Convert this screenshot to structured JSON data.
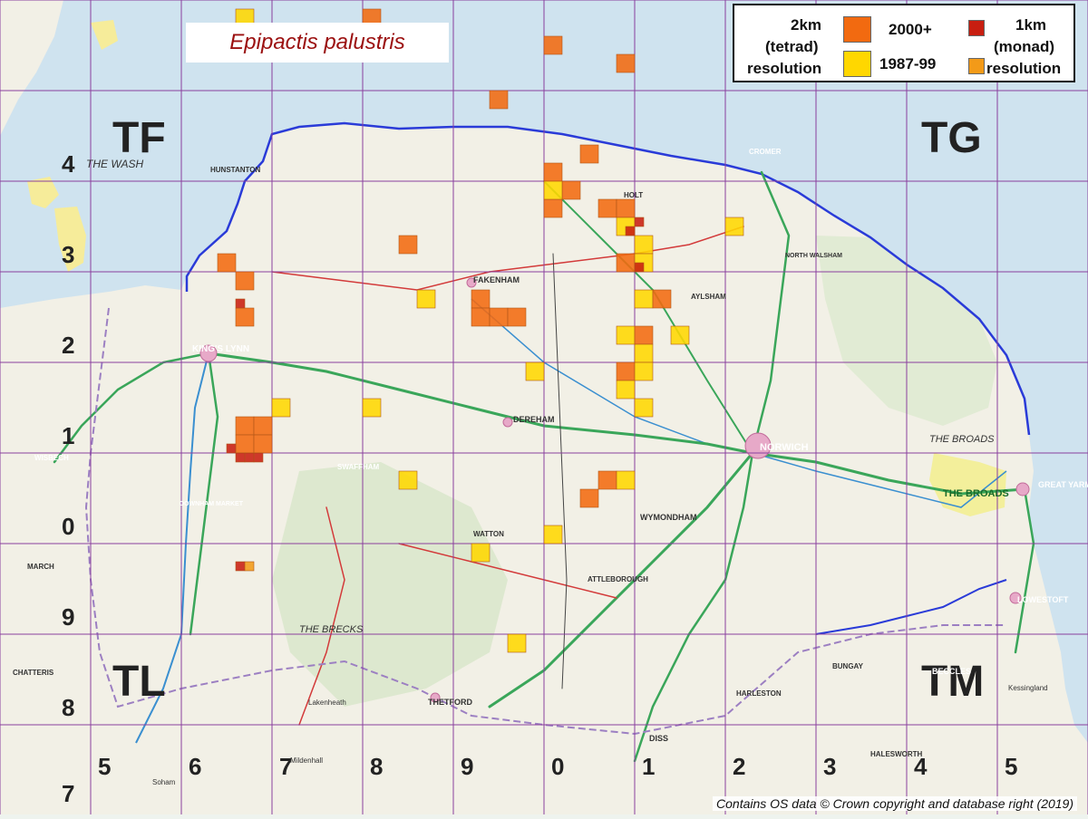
{
  "title": "Epipactis palustris",
  "legend": {
    "tetrad_label_1": "2km",
    "tetrad_label_2": "(tetrad)",
    "tetrad_label_3": "resolution",
    "period_recent": "2000+",
    "period_old": "1987-99",
    "monad_label_1": "1km",
    "monad_label_2": "(monad)",
    "monad_label_3": "resolution"
  },
  "colors": {
    "tetrad_recent": "#f26a10",
    "tetrad_old": "#ffd700",
    "monad_recent": "#c81e10",
    "monad_old": "#f39a18",
    "grid": "#8a3f9e",
    "coast": "#2a3bd8"
  },
  "squares": {
    "tl": "TL",
    "tf": "TF",
    "tg": "TG",
    "tm": "TM"
  },
  "grid_numbers": {
    "left": [
      "4",
      "3",
      "2",
      "1",
      "0",
      "9",
      "8",
      "7"
    ],
    "bottom": [
      "5",
      "6",
      "7",
      "8",
      "9",
      "0",
      "1",
      "2",
      "3",
      "4",
      "5"
    ]
  },
  "copyright": "Contains OS data © Crown copyright and database right (2019)",
  "map_labels": {
    "the_wash": "THE WASH",
    "the_broads_1": "THE BROADS",
    "the_broads_2": "THE BROADS",
    "the_brecks": "THE BRECKS",
    "kings_lynn": "KING'S LYNN",
    "norwich": "NORWICH",
    "great_yarmouth": "GREAT YARMOUTH",
    "lowestoft": "LOWESTOFT",
    "cromer": "CROMER",
    "fakenham": "FAKENHAM",
    "thetford": "THETFORD",
    "beccles": "BECCLES",
    "diss": "DISS",
    "swaffham": "SWAFFHAM",
    "downham_market": "DOWNHAM MARKET",
    "wisbech": "WISBECH",
    "hunstanton": "HUNSTANTON",
    "dereham": "DEREHAM",
    "wymondham": "WYMONDHAM",
    "attleborough": "ATTLEBOROUGH",
    "aylsham": "AYLSHAM",
    "north_walsham": "NORTH WALSHAM",
    "holt": "HOLT",
    "harleston": "HARLESTON",
    "bungay": "BUNGAY",
    "watton": "WATTON",
    "march": "MARCH",
    "chatteris": "CHATTERIS",
    "lakenheath": "Lakenheath",
    "halesworth": "HALESWORTH",
    "soham": "Soham",
    "mildenhall": "Mildenhall",
    "kessingland": "Kessingland"
  },
  "records": [
    {
      "period": "old",
      "res": "tetrad",
      "easting": 572,
      "northing": 345
    },
    {
      "period": "recent",
      "res": "tetrad",
      "easting": 586,
      "northing": 345
    },
    {
      "period": "recent",
      "res": "monad",
      "easting": 585,
      "northing": 344
    },
    {
      "period": "recent",
      "res": "monad",
      "easting": 586,
      "northing": 344
    },
    {
      "period": "recent",
      "res": "monad",
      "easting": 587,
      "northing": 344
    },
    {
      "period": "old",
      "res": "monad",
      "easting": 590,
      "northing": 344
    },
    {
      "period": "recent",
      "res": "monad",
      "easting": 591,
      "northing": 344
    },
    {
      "period": "recent",
      "res": "tetrad",
      "easting": 592,
      "northing": 342
    },
    {
      "period": "recent",
      "res": "tetrad",
      "easting": 606,
      "northing": 342
    },
    {
      "period": "recent",
      "res": "tetrad",
      "easting": 614,
      "northing": 340
    },
    {
      "period": "recent",
      "res": "tetrad",
      "easting": 600,
      "northing": 336
    },
    {
      "period": "recent",
      "res": "tetrad",
      "easting": 610,
      "northing": 330
    },
    {
      "period": "recent",
      "res": "tetrad",
      "easting": 612,
      "northing": 324
    },
    {
      "period": "recent",
      "res": "tetrad",
      "easting": 614,
      "northing": 324
    },
    {
      "period": "old",
      "res": "tetrad",
      "easting": 614,
      "northing": 322
    },
    {
      "period": "recent",
      "res": "monad",
      "easting": 616,
      "northing": 323
    },
    {
      "period": "recent",
      "res": "monad",
      "easting": 615,
      "northing": 322
    },
    {
      "period": "old",
      "res": "tetrad",
      "easting": 616,
      "northing": 320
    },
    {
      "period": "recent",
      "res": "tetrad",
      "easting": 614,
      "northing": 318
    },
    {
      "period": "old",
      "res": "tetrad",
      "easting": 616,
      "northing": 318
    },
    {
      "period": "recent",
      "res": "monad",
      "easting": 616,
      "northing": 318
    },
    {
      "period": "old",
      "res": "tetrad",
      "easting": 616,
      "northing": 314
    },
    {
      "period": "recent",
      "res": "tetrad",
      "easting": 618,
      "northing": 314
    },
    {
      "period": "old",
      "res": "tetrad",
      "easting": 614,
      "northing": 310
    },
    {
      "period": "recent",
      "res": "tetrad",
      "easting": 616,
      "northing": 310
    },
    {
      "period": "old",
      "res": "tetrad",
      "easting": 616,
      "northing": 308
    },
    {
      "period": "recent",
      "res": "tetrad",
      "easting": 614,
      "northing": 306
    },
    {
      "period": "old",
      "res": "tetrad",
      "easting": 616,
      "northing": 306
    },
    {
      "period": "old",
      "res": "tetrad",
      "easting": 614,
      "northing": 304
    },
    {
      "period": "old",
      "res": "tetrad",
      "easting": 616,
      "northing": 302
    },
    {
      "period": "old",
      "res": "tetrad",
      "easting": 620,
      "northing": 310
    },
    {
      "period": "old",
      "res": "tetrad",
      "easting": 626,
      "northing": 322
    },
    {
      "period": "recent",
      "res": "tetrad",
      "easting": 570,
      "northing": 318
    },
    {
      "period": "recent",
      "res": "tetrad",
      "easting": 572,
      "northing": 316
    },
    {
      "period": "recent",
      "res": "tetrad",
      "easting": 572,
      "northing": 312
    },
    {
      "period": "recent",
      "res": "monad",
      "easting": 572,
      "northing": 314
    },
    {
      "period": "recent",
      "res": "tetrad",
      "easting": 572,
      "northing": 300
    },
    {
      "period": "recent",
      "res": "tetrad",
      "easting": 574,
      "northing": 300
    },
    {
      "period": "recent",
      "res": "tetrad",
      "easting": 572,
      "northing": 298
    },
    {
      "period": "recent",
      "res": "tetrad",
      "easting": 574,
      "northing": 298
    },
    {
      "period": "old",
      "res": "tetrad",
      "easting": 576,
      "northing": 302
    },
    {
      "period": "recent",
      "res": "monad",
      "easting": 574,
      "northing": 297
    },
    {
      "period": "recent",
      "res": "monad",
      "easting": 573,
      "northing": 297
    },
    {
      "period": "recent",
      "res": "monad",
      "easting": 572,
      "northing": 297
    },
    {
      "period": "recent",
      "res": "monad",
      "easting": 571,
      "northing": 298
    },
    {
      "period": "recent",
      "res": "monad",
      "easting": 572,
      "northing": 285
    },
    {
      "period": "old",
      "res": "monad",
      "easting": 573,
      "northing": 285
    },
    {
      "period": "old",
      "res": "tetrad",
      "easting": 586,
      "northing": 302
    },
    {
      "period": "old",
      "res": "tetrad",
      "easting": 590,
      "northing": 294
    },
    {
      "period": "recent",
      "res": "tetrad",
      "easting": 590,
      "northing": 320
    },
    {
      "period": "old",
      "res": "tetrad",
      "easting": 592,
      "northing": 314
    },
    {
      "period": "recent",
      "res": "tetrad",
      "easting": 598,
      "northing": 314
    },
    {
      "period": "recent",
      "res": "tetrad",
      "easting": 598,
      "northing": 312
    },
    {
      "period": "recent",
      "res": "tetrad",
      "easting": 600,
      "northing": 312
    },
    {
      "period": "recent",
      "res": "tetrad",
      "easting": 602,
      "northing": 312
    },
    {
      "period": "old",
      "res": "tetrad",
      "easting": 604,
      "northing": 306
    },
    {
      "period": "recent",
      "res": "tetrad",
      "easting": 606,
      "northing": 324
    },
    {
      "period": "recent",
      "res": "tetrad",
      "easting": 608,
      "northing": 326
    },
    {
      "period": "recent",
      "res": "tetrad",
      "easting": 606,
      "northing": 328
    },
    {
      "period": "old",
      "res": "tetrad",
      "easting": 606,
      "northing": 326
    },
    {
      "period": "recent",
      "res": "tetrad",
      "easting": 610,
      "northing": 292
    },
    {
      "period": "recent",
      "res": "tetrad",
      "easting": 612,
      "northing": 294
    },
    {
      "period": "old",
      "res": "tetrad",
      "easting": 614,
      "northing": 294
    },
    {
      "period": "old",
      "res": "tetrad",
      "easting": 598,
      "northing": 286
    },
    {
      "period": "old",
      "res": "tetrad",
      "easting": 602,
      "northing": 276
    },
    {
      "period": "old",
      "res": "tetrad",
      "easting": 606,
      "northing": 288
    }
  ]
}
